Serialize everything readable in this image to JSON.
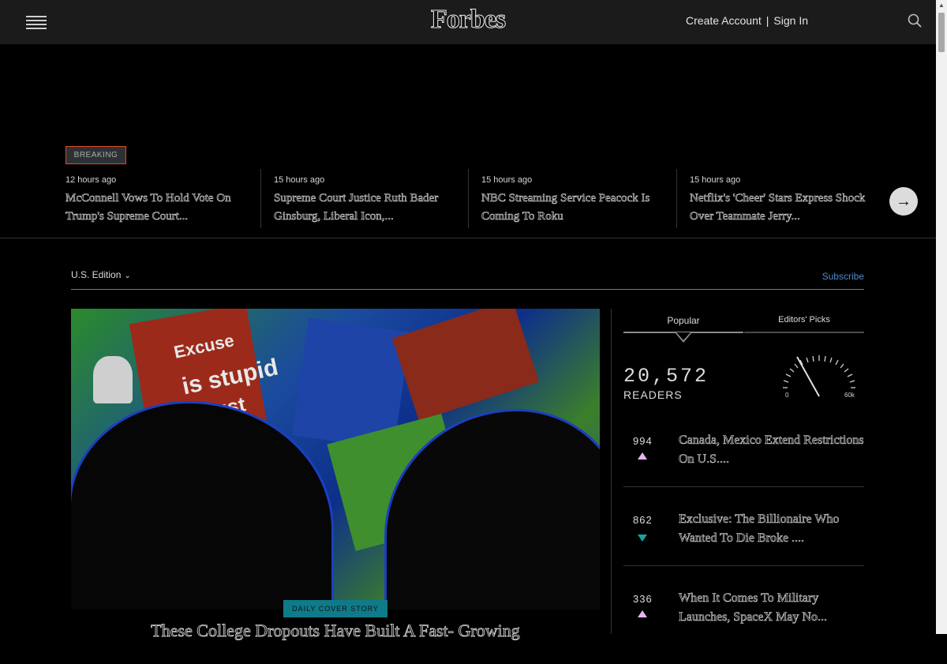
{
  "header": {
    "logo": "Forbes",
    "create_account": "Create Account",
    "separator": "|",
    "sign_in": "Sign In"
  },
  "breaking": {
    "badge": "BREAKING",
    "items": [
      {
        "time": "12 hours ago",
        "title": "McConnell Vows To Hold Vote On Trump's Supreme Court..."
      },
      {
        "time": "15 hours ago",
        "title": "Supreme Court Justice Ruth Bader Ginsburg, Liberal Icon,..."
      },
      {
        "time": "15 hours ago",
        "title": "NBC Streaming Service Peacock Is Coming To Roku"
      },
      {
        "time": "15 hours ago",
        "title": "Netflix's 'Cheer' Stars Express Shock Over Teammate Jerry..."
      }
    ],
    "next_icon": "arrow-right-icon"
  },
  "edition": {
    "label": "U.S. Edition",
    "subscribe": "Subscribe"
  },
  "hero": {
    "text1": "Excuse",
    "text2": "is stupid",
    "text3": "just",
    "tag": "DAILY COVER STORY",
    "headline": "These College Dropouts Have Built A Fast- Growing"
  },
  "sidebar": {
    "tabs": [
      "Popular",
      "Editors' Picks"
    ],
    "readers_count": "20,572",
    "readers_label": "READERS",
    "gauge_min": "0",
    "gauge_max": "60k",
    "items": [
      {
        "rank": "994",
        "trend": "up",
        "title": "Canada, Mexico Extend Restrictions On U.S...."
      },
      {
        "rank": "862",
        "trend": "down",
        "title": "Exclusive: The Billionaire Who Wanted To Die Broke ...."
      },
      {
        "rank": "336",
        "trend": "up",
        "title": "When It Comes To Military Launches, SpaceX May No..."
      }
    ]
  },
  "colors": {
    "accent_link": "#4e8cc9",
    "breaking_border": "#e04a2a",
    "trend_up": "#e6b6f0",
    "trend_down": "#1aa3a3"
  }
}
